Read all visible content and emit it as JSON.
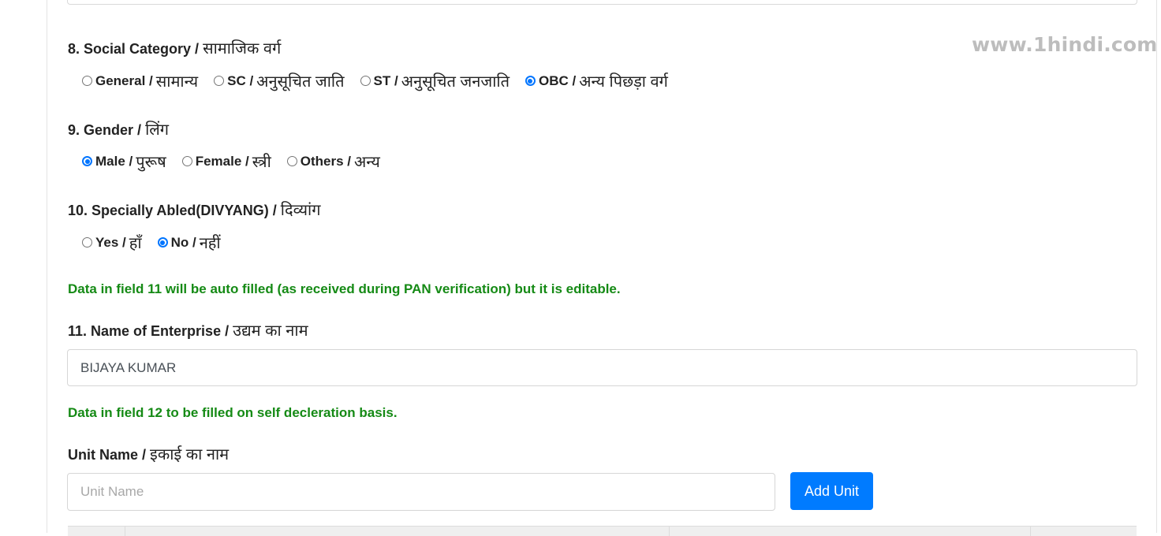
{
  "watermark": "www.1hindi.com",
  "fields": {
    "social_category": {
      "label_en": "8. Social Category /",
      "label_hi": "सामाजिक वर्ग",
      "options": [
        {
          "en": "General /",
          "hi": "सामान्य",
          "checked": false
        },
        {
          "en": "SC /",
          "hi": "अनुसूचित जाति",
          "checked": false
        },
        {
          "en": "ST /",
          "hi": "अनुसूचित जनजाति",
          "checked": false
        },
        {
          "en": "OBC /",
          "hi": "अन्य पिछड़ा वर्ग",
          "checked": true
        }
      ]
    },
    "gender": {
      "label_en": "9. Gender /",
      "label_hi": "लिंग",
      "options": [
        {
          "en": "Male /",
          "hi": "पुरूष",
          "checked": true
        },
        {
          "en": "Female /",
          "hi": "स्त्री",
          "checked": false
        },
        {
          "en": "Others /",
          "hi": "अन्य",
          "checked": false
        }
      ]
    },
    "divyang": {
      "label_en": "10. Specially Abled(DIVYANG) /",
      "label_hi": "दिव्यांग",
      "options": [
        {
          "en": "Yes /",
          "hi": "हाँ",
          "checked": false
        },
        {
          "en": "No /",
          "hi": "नहीं",
          "checked": true
        }
      ]
    },
    "note_11": "Data in field 11 will be auto filled (as received during PAN verification) but it is editable.",
    "enterprise_name": {
      "label_en": "11. Name of Enterprise /",
      "label_hi": "उद्यम का नाम",
      "value": "BIJAYA KUMAR"
    },
    "note_12": "Data in field 12 to be filled on self decleration basis.",
    "unit_name": {
      "label_en": "Unit Name /",
      "label_hi": "इकाई का नाम",
      "placeholder": "Unit Name",
      "value": "",
      "add_button": "Add Unit"
    }
  },
  "colors": {
    "accent": "#007bff",
    "radio_checked": "#0075ff",
    "note_green": "#158a15",
    "watermark": "#bdbdbd"
  }
}
